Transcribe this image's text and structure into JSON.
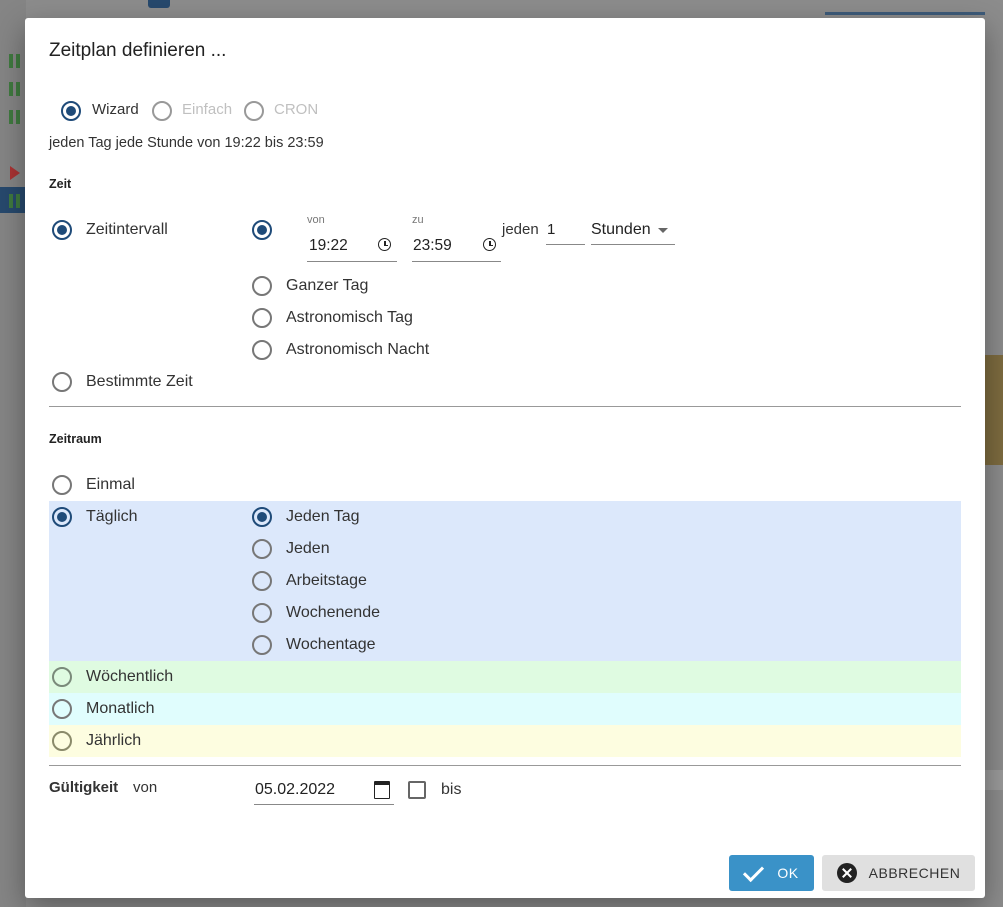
{
  "dialog": {
    "title": "Zeitplan definieren ...",
    "modes": [
      "Wizard",
      "Einfach",
      "CRON"
    ],
    "summary": "jeden Tag jede Stunde von 19:22 bis 23:59"
  },
  "time": {
    "section": "Zeit",
    "interval_label": "Zeitintervall",
    "from_label": "von",
    "from_value": "19:22",
    "to_label": "zu",
    "to_value": "23:59",
    "every_label": "jeden",
    "every_value": "1",
    "unit_value": "Stunden",
    "options": [
      "Ganzer Tag",
      "Astronomisch Tag",
      "Astronomisch Nacht"
    ],
    "specific_label": "Bestimmte Zeit"
  },
  "period": {
    "section": "Zeitraum",
    "once": "Einmal",
    "daily": "Täglich",
    "daily_options": [
      "Jeden Tag",
      "Jeden",
      "Arbeitstage",
      "Wochenende",
      "Wochentage"
    ],
    "weekly": "Wöchentlich",
    "monthly": "Monatlich",
    "yearly": "Jährlich"
  },
  "validity": {
    "label": "Gültigkeit",
    "from_label": "von",
    "from_value": "05.02.2022",
    "to_label": "bis"
  },
  "buttons": {
    "ok": "OK",
    "cancel": "ABBRECHEN"
  },
  "colors": {
    "primary": "#1f4b79",
    "ok_button": "#3a92c8",
    "daily_band": "#dce8fb",
    "weekly_band": "#dffbe1",
    "monthly_band": "#e0fdfd",
    "yearly_band": "#fdfde0"
  }
}
